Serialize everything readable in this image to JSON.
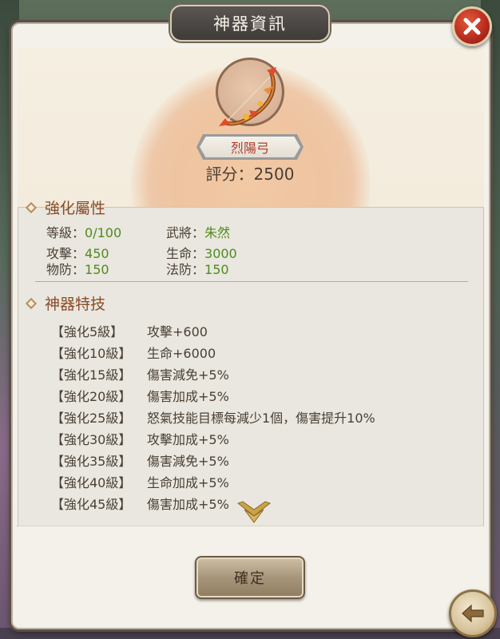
{
  "dialog": {
    "title": "神器資訊",
    "close_icon": "close-icon"
  },
  "item": {
    "name": "烈陽弓",
    "score_label": "評分：",
    "score_value": "2500",
    "icon": "bow-icon"
  },
  "attributes": {
    "header": "強化屬性",
    "rows": [
      {
        "label": "等級：",
        "value": "0/100"
      },
      {
        "label": "武將：",
        "value": "朱然"
      },
      {
        "label": "攻擊：",
        "value": "450"
      },
      {
        "label": "生命：",
        "value": "3000"
      },
      {
        "label": "物防：",
        "value": "150"
      },
      {
        "label": "法防：",
        "value": "150"
      }
    ]
  },
  "skills": {
    "header": "神器特技",
    "rows": [
      {
        "level": "【強化5級】",
        "effect": "攻擊+600"
      },
      {
        "level": "【強化10級】",
        "effect": "生命+6000"
      },
      {
        "level": "【強化15級】",
        "effect": "傷害減免+5%"
      },
      {
        "level": "【強化20級】",
        "effect": "傷害加成+5%"
      },
      {
        "level": "【強化25級】",
        "effect": "怒氣技能目標每減少1個，傷害提升10%"
      },
      {
        "level": "【強化30級】",
        "effect": "攻擊加成+5%"
      },
      {
        "level": "【強化35級】",
        "effect": "傷害減免+5%"
      },
      {
        "level": "【強化40級】",
        "effect": "生命加成+5%"
      },
      {
        "level": "【強化45級】",
        "effect": "傷害加成+5%"
      }
    ]
  },
  "buttons": {
    "confirm_label": "確定",
    "back_icon": "back-arrow-icon"
  },
  "colors": {
    "value_green": "#4f8a1e",
    "header_brown": "#8a4b26",
    "name_red": "#b23a2c"
  }
}
